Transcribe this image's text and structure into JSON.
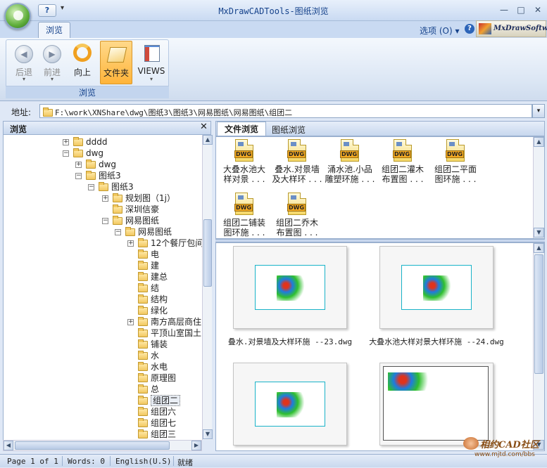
{
  "window": {
    "title": "MxDrawCADTools-图纸浏览",
    "help_glyph": "?",
    "qat_dropdown": "▾",
    "minimize": "—",
    "maximize": "□",
    "close": "✕"
  },
  "ribbon": {
    "tab": "浏览",
    "options_label": "选项 (O)",
    "options_arrow": "▾",
    "help_glyph": "?",
    "logo": "MxDrawSoftware",
    "group_label": "浏览",
    "buttons": [
      {
        "label": "后退",
        "icon": "back-arrow-icon",
        "glyph": "◀",
        "arrow": "▾"
      },
      {
        "label": "前进",
        "icon": "forward-arrow-icon",
        "glyph": "▶",
        "arrow": "▾"
      },
      {
        "label": "向上",
        "icon": "up-arrow-icon",
        "glyph": "↰",
        "arrow": ""
      },
      {
        "label": "文件夹",
        "icon": "folder-icon",
        "glyph": "",
        "arrow": ""
      },
      {
        "label": "VIEWS",
        "icon": "views-grid-icon",
        "glyph": "",
        "arrow": "▾"
      }
    ]
  },
  "address": {
    "label": "地址:",
    "path": "F:\\work\\XNShare\\dwg\\图纸3\\图纸3\\网易图纸\\网易图纸\\组团二",
    "dropdown": "▾"
  },
  "left_panel": {
    "title": "浏览",
    "close": "✕",
    "tree": [
      {
        "label": "dddd",
        "toggle": "+",
        "indent": 84
      },
      {
        "label": "dwg",
        "toggle": "−",
        "indent": 84
      },
      {
        "label": "dwg",
        "toggle": "+",
        "indent": 102
      },
      {
        "label": "图纸3",
        "toggle": "−",
        "indent": 102
      },
      {
        "label": "图纸3",
        "toggle": "−",
        "indent": 120
      },
      {
        "label": "规划图（1j）",
        "toggle": "+",
        "indent": 140
      },
      {
        "label": "深圳信豪",
        "toggle": "",
        "indent": 140
      },
      {
        "label": "网易图纸",
        "toggle": "−",
        "indent": 140
      },
      {
        "label": "网易图纸",
        "toggle": "−",
        "indent": 158
      },
      {
        "label": "12个餐厅包间",
        "toggle": "+",
        "indent": 176
      },
      {
        "label": "电",
        "toggle": "",
        "indent": 176
      },
      {
        "label": "建",
        "toggle": "",
        "indent": 176
      },
      {
        "label": "建总",
        "toggle": "",
        "indent": 176
      },
      {
        "label": "结",
        "toggle": "",
        "indent": 176
      },
      {
        "label": "结构",
        "toggle": "",
        "indent": 176
      },
      {
        "label": "绿化",
        "toggle": "",
        "indent": 176
      },
      {
        "label": "南方高层商住",
        "toggle": "+",
        "indent": 176
      },
      {
        "label": "平顶山室国土",
        "toggle": "",
        "indent": 176
      },
      {
        "label": "铺装",
        "toggle": "",
        "indent": 176
      },
      {
        "label": "水",
        "toggle": "",
        "indent": 176
      },
      {
        "label": "水电",
        "toggle": "",
        "indent": 176
      },
      {
        "label": "原理图",
        "toggle": "",
        "indent": 176
      },
      {
        "label": "总",
        "toggle": "",
        "indent": 176
      },
      {
        "label": "组团二",
        "toggle": "",
        "indent": 176,
        "selected": true
      },
      {
        "label": "组团六",
        "toggle": "",
        "indent": 176
      },
      {
        "label": "组团七",
        "toggle": "",
        "indent": 176
      },
      {
        "label": "组团三",
        "toggle": "",
        "indent": 176
      }
    ],
    "scroll_up": "▲",
    "scroll_down": "▼",
    "scroll_left": "◀",
    "scroll_right": "▶"
  },
  "right_panel": {
    "tabs": [
      "文件浏览",
      "图纸浏览"
    ],
    "dwg_badge": "DWG",
    "files": [
      {
        "line1": "大叠水池大",
        "line2": "样对景 . . ."
      },
      {
        "line1": "叠水.对景墙",
        "line2": "及大样环 . . ."
      },
      {
        "line1": "涌水池.小品",
        "line2": "雕塑环施 . . ."
      },
      {
        "line1": "组团二灌木",
        "line2": "布置图 . . ."
      },
      {
        "line1": "组团二平面",
        "line2": "图环施 . . ."
      },
      {
        "line1": "组团二铺装",
        "line2": "图环施 . . ."
      },
      {
        "line1": "组团二乔木",
        "line2": "布置图 . . ."
      }
    ],
    "thumbnails": [
      {
        "caption": "叠水.对景墙及大样环施 --23.dwg"
      },
      {
        "caption": "大叠水池大样对景大样环施 --24.dwg"
      },
      {
        "caption": ""
      },
      {
        "caption": ""
      }
    ],
    "scroll_up": "▲",
    "scroll_down": "▼"
  },
  "status": {
    "page": "Page 1 of 1",
    "words": "Words: 0",
    "language": "English(U.S)",
    "state": "就绪"
  },
  "watermark": {
    "text": "相约CAD社区",
    "url": "www.mjtd.com/bbs"
  }
}
